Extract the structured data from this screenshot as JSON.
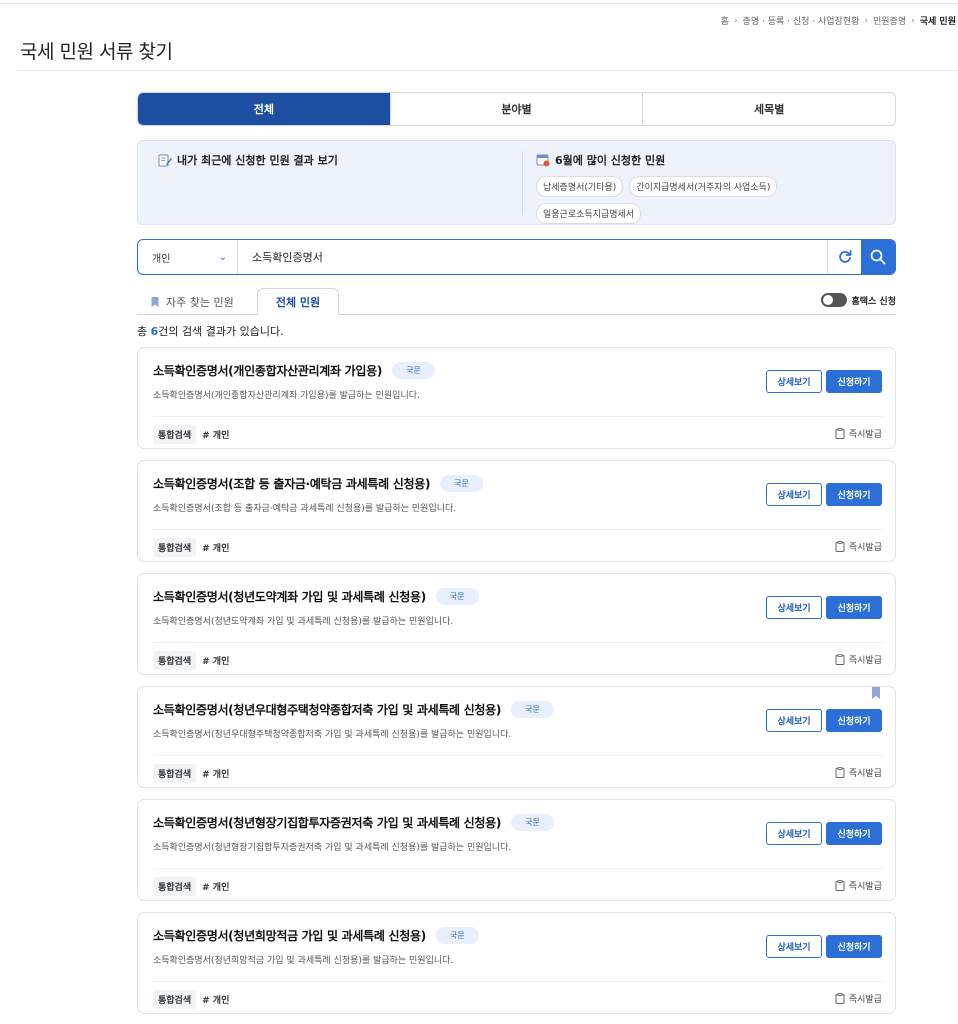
{
  "breadcrumb": [
    "홈",
    "증명 · 등록 · 신청 · 사업장현황",
    "민원증명",
    "국세 민원"
  ],
  "page_title": "국세 민원 서류 찾기",
  "tabs": [
    {
      "label": "전체",
      "active": true
    },
    {
      "label": "분야별",
      "active": false
    },
    {
      "label": "세목별",
      "active": false
    }
  ],
  "info": {
    "recent_label": "내가 최근에 신청한 민원 결과 보기",
    "popular_title": "6월에 많이 신청한 민원",
    "popular_items": [
      "납세증명서(기타용)",
      "간이지급명세서(거주자의 사업소득)",
      "일용근로소득지급명세서"
    ]
  },
  "search": {
    "type_value": "개인",
    "query": "소득확인증명서"
  },
  "subtabs": {
    "favorites": "자주 찾는 민원",
    "all": "전체 민원",
    "hometax_toggle": "홈택스 신청"
  },
  "result": {
    "prefix": "총 ",
    "count": "6",
    "suffix": "건의 검색 결과가 있습니다."
  },
  "card_labels": {
    "detail": "상세보기",
    "apply": "신청하기",
    "category": "통합검색",
    "tag": "# 개인",
    "instant": "즉시발급",
    "badge": "국문"
  },
  "cards": [
    {
      "title": "소득확인증명서(개인종합자산관리계좌 가입용)",
      "desc": "소득확인증명서(개인종합자산관리계좌 가입용)를 발급하는 민원입니다.",
      "bookmarked": false
    },
    {
      "title": "소득확인증명서(조합 등 출자금·예탁금 과세특례 신청용)",
      "desc": "소득확인증명서(조합 등 출자금·예탁금 과세특례 신청용)를 발급하는 민원입니다.",
      "bookmarked": false
    },
    {
      "title": "소득확인증명서(청년도약계좌 가입 및 과세특례 신청용)",
      "desc": "소득확인증명서(청년도약계좌 가입 및 과세특례 신청용)를 발급하는 민원입니다.",
      "bookmarked": false
    },
    {
      "title": "소득확인증명서(청년우대형주택청약종합저축 가입 및 과세특례 신청용)",
      "desc": "소득확인증명서(청년우대형주택청약종합저축 가입 및 과세특례 신청용)를 발급하는 민원입니다.",
      "bookmarked": true
    },
    {
      "title": "소득확인증명서(청년형장기집합투자증권저축 가입 및 과세특례 신청용)",
      "desc": "소득확인증명서(청년형장기집합투자증권저축 가입 및 과세특례 신청용)를 발급하는 민원입니다.",
      "bookmarked": false
    },
    {
      "title": "소득확인증명서(청년희망적금 가입 및 과세특례 신청용)",
      "desc": "소득확인증명서(청년희망적금 가입 및 과세특례 신청용)를 발급하는 민원입니다.",
      "bookmarked": false
    }
  ],
  "colors": {
    "primary": "#2c6fd6",
    "tab_active": "#1e4fa3",
    "info_bg": "#eef3fb",
    "badge_bg": "#e8f0fd"
  },
  "icons": {
    "recent": "memo-pencil-icon",
    "popular": "calendar-icon",
    "reset": "refresh-icon",
    "search": "search-icon",
    "favorites": "bookmark-icon",
    "instant": "document-icon"
  }
}
